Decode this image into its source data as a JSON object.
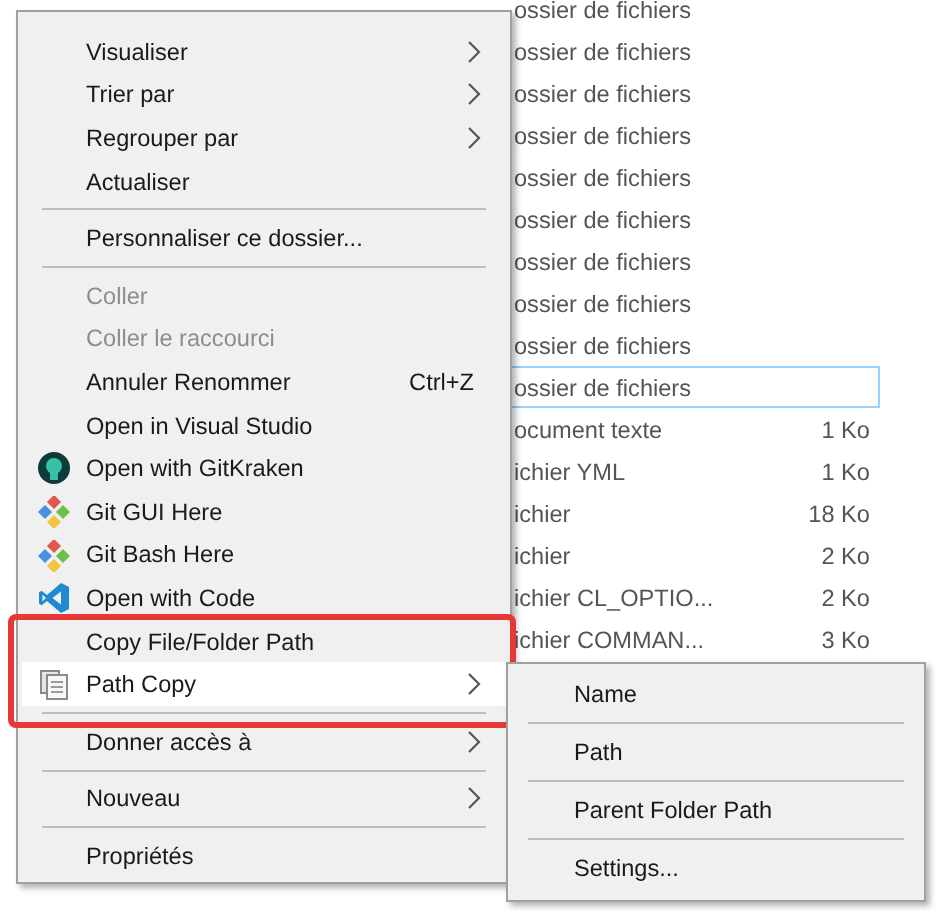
{
  "file_list": {
    "rows": [
      {
        "type": "ossier de fichiers",
        "size": "",
        "selected": false
      },
      {
        "type": "ossier de fichiers",
        "size": "",
        "selected": false
      },
      {
        "type": "ossier de fichiers",
        "size": "",
        "selected": false
      },
      {
        "type": "ossier de fichiers",
        "size": "",
        "selected": false
      },
      {
        "type": "ossier de fichiers",
        "size": "",
        "selected": false
      },
      {
        "type": "ossier de fichiers",
        "size": "",
        "selected": false
      },
      {
        "type": "ossier de fichiers",
        "size": "",
        "selected": false
      },
      {
        "type": "ossier de fichiers",
        "size": "",
        "selected": false
      },
      {
        "type": "ossier de fichiers",
        "size": "",
        "selected": false
      },
      {
        "type": "ossier de fichiers",
        "size": "",
        "selected": true
      },
      {
        "type": "ocument texte",
        "size": "1 Ko",
        "selected": false
      },
      {
        "type": "ichier YML",
        "size": "1 Ko",
        "selected": false
      },
      {
        "type": "ichier",
        "size": "18 Ko",
        "selected": false
      },
      {
        "type": "ichier",
        "size": "2 Ko",
        "selected": false
      },
      {
        "type": "ichier CL_OPTIO...",
        "size": "2 Ko",
        "selected": false
      },
      {
        "type": "ichier COMMAN...",
        "size": "3 Ko",
        "selected": false
      }
    ]
  },
  "context_menu": {
    "items": [
      {
        "kind": "item",
        "label": "Visualiser",
        "submenu": true,
        "disabled": false,
        "selected": false
      },
      {
        "kind": "item",
        "label": "Trier par",
        "submenu": true,
        "disabled": false,
        "selected": false
      },
      {
        "kind": "item",
        "label": "Regrouper par",
        "submenu": true,
        "disabled": false,
        "selected": false
      },
      {
        "kind": "item",
        "label": "Actualiser",
        "submenu": false,
        "disabled": false,
        "selected": false
      },
      {
        "kind": "separator"
      },
      {
        "kind": "item",
        "label": "Personnaliser ce dossier...",
        "submenu": false,
        "disabled": false,
        "selected": false
      },
      {
        "kind": "separator"
      },
      {
        "kind": "item",
        "label": "Coller",
        "submenu": false,
        "disabled": true,
        "selected": false
      },
      {
        "kind": "item",
        "label": "Coller le raccourci",
        "submenu": false,
        "disabled": true,
        "selected": false
      },
      {
        "kind": "item",
        "label": "Annuler Renommer",
        "shortcut": "Ctrl+Z",
        "submenu": false,
        "disabled": false,
        "selected": false
      },
      {
        "kind": "item",
        "label": "Open in Visual Studio",
        "submenu": false,
        "disabled": false,
        "selected": false
      },
      {
        "kind": "gitkraken",
        "label": "Open with GitKraken",
        "submenu": false,
        "disabled": false,
        "selected": false
      },
      {
        "kind": "git",
        "label": "Git GUI Here",
        "submenu": false,
        "disabled": false,
        "selected": false
      },
      {
        "kind": "git",
        "label": "Git Bash Here",
        "submenu": false,
        "disabled": false,
        "selected": false
      },
      {
        "kind": "vscode",
        "label": "Open with Code",
        "submenu": false,
        "disabled": false,
        "selected": false
      },
      {
        "kind": "item",
        "label": "Copy File/Folder Path",
        "submenu": false,
        "disabled": false,
        "selected": false
      },
      {
        "kind": "document",
        "label": "Path Copy",
        "submenu": true,
        "disabled": false,
        "selected": true
      },
      {
        "kind": "separator"
      },
      {
        "kind": "item",
        "label": "Donner accès à",
        "submenu": true,
        "disabled": false,
        "selected": false
      },
      {
        "kind": "separator"
      },
      {
        "kind": "item",
        "label": "Nouveau",
        "submenu": true,
        "disabled": false,
        "selected": false
      },
      {
        "kind": "separator"
      },
      {
        "kind": "item",
        "label": "Propriétés",
        "submenu": false,
        "disabled": false,
        "selected": false
      }
    ]
  },
  "submenu": {
    "items": [
      {
        "label": "Name"
      },
      {
        "label": "Path"
      },
      {
        "label": "Parent Folder Path"
      },
      {
        "label": "Settings..."
      }
    ]
  }
}
